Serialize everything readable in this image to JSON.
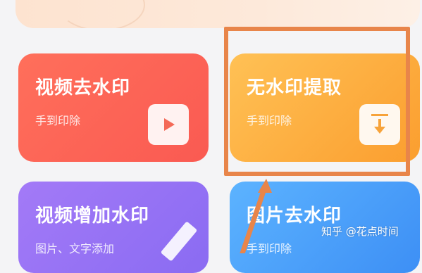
{
  "cards": [
    {
      "title": "视频去水印",
      "subtitle": "手到印除",
      "icon": "play-icon"
    },
    {
      "title": "无水印提取",
      "subtitle": "手到印除",
      "icon": "download-icon"
    },
    {
      "title": "视频增加水印",
      "subtitle": "图片、文字添加",
      "icon": "pencil-icon"
    },
    {
      "title": "图片去水印",
      "subtitle": "手到印除",
      "icon": "image-icon"
    }
  ],
  "annotation": {
    "color": "#e8854a"
  },
  "watermark": {
    "text": "知乎 @花点时间"
  },
  "colors": {
    "video_remove": "#fa5a52",
    "no_watermark": "#fb9e2f",
    "video_add": "#8a6bf2",
    "image_remove": "#3d8ff5"
  }
}
